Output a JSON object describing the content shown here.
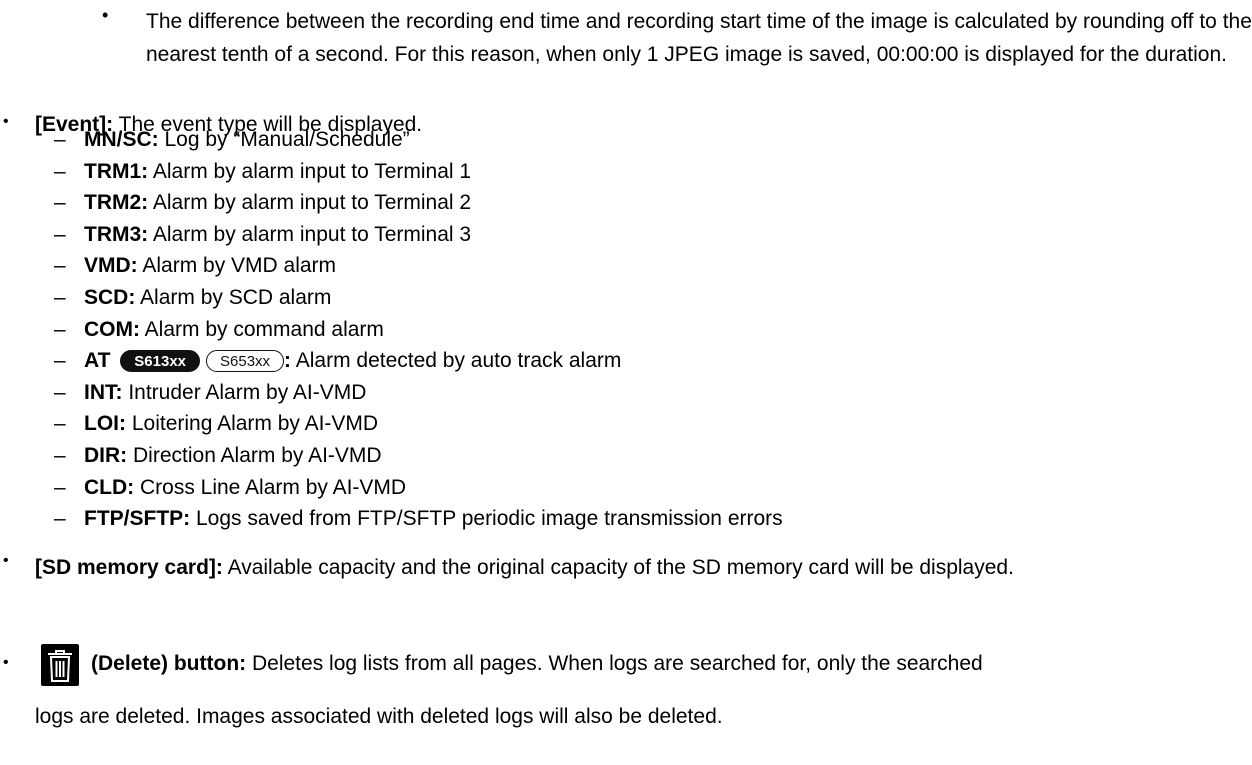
{
  "duration_note": {
    "bullet": "•",
    "text": "The difference between the recording end time and recording start time of the image is calculated by rounding off to the nearest tenth of a second. For this reason, when only 1 JPEG image is saved, 00:00:00 is displayed for the duration."
  },
  "event": {
    "bullet": "•",
    "label": "[Event]:",
    "text": " The event type will be displayed.",
    "dash": "–",
    "items": [
      {
        "code": "MN/SC:",
        "desc": " Log by “Manual/Schedule”"
      },
      {
        "code": "TRM1:",
        "desc": " Alarm by alarm input to Terminal 1"
      },
      {
        "code": "TRM2:",
        "desc": " Alarm by alarm input to Terminal 2"
      },
      {
        "code": "TRM3:",
        "desc": " Alarm by alarm input to Terminal 3"
      },
      {
        "code": "VMD:",
        "desc": " Alarm by VMD alarm"
      },
      {
        "code": "SCD:",
        "desc": " Alarm by SCD alarm"
      },
      {
        "code": "COM:",
        "desc": " Alarm by command alarm"
      },
      {
        "code": "AT",
        "badge1": "S613xx",
        "badge2": "S653xx",
        "colon": ":",
        "desc": " Alarm detected by auto track alarm"
      },
      {
        "code": "INT:",
        "desc": " Intruder Alarm by AI-VMD"
      },
      {
        "code": "LOI:",
        "desc": " Loitering Alarm by AI-VMD"
      },
      {
        "code": "DIR:",
        "desc": " Direction Alarm by AI-VMD"
      },
      {
        "code": "CLD:",
        "desc": " Cross Line Alarm by AI-VMD"
      },
      {
        "code": "FTP/SFTP:",
        "desc": " Logs saved from FTP/SFTP periodic image transmission errors"
      }
    ]
  },
  "sd_card": {
    "bullet": "•",
    "label": "[SD memory card]:",
    "text": " Available capacity and the original capacity of the SD memory card will be displayed."
  },
  "delete": {
    "bullet": "•",
    "icon": "trash-icon",
    "label": "(Delete) button:",
    "text_line1": " Deletes log lists from all pages. When logs are searched for, only the searched",
    "text_line2": "logs are deleted. Images associated with deleted logs will also be deleted."
  }
}
